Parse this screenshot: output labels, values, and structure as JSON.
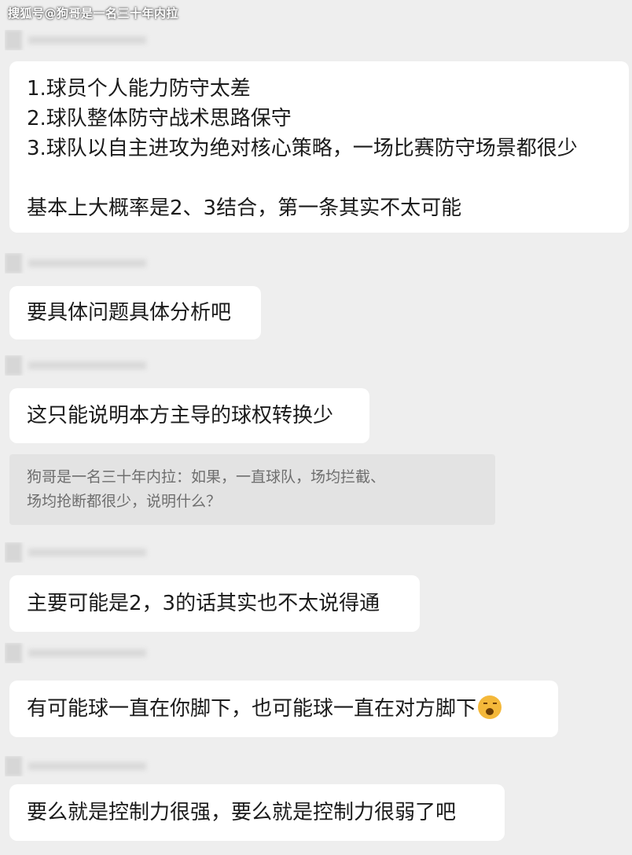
{
  "watermark": "搜狐号@狗哥是一名三十年内拉",
  "messages": [
    {
      "lines": [
        "1.球员个人能力防守太差",
        "2.球队整体防守战术思路保守",
        "3.球队以自主进攻为绝对核心策略，一场比赛防守场景都很少",
        "",
        "基本上大概率是2、3结合，第一条其实不太可能"
      ]
    },
    {
      "lines": [
        "要具体问题具体分析吧"
      ]
    },
    {
      "lines": [
        "这只能说明本方主导的球权转换少"
      ]
    },
    {
      "lines": [
        "主要可能是2，3的话其实也不太说得通"
      ]
    },
    {
      "lines": [
        "有可能球一直在你脚下，也可能球一直在对方脚下"
      ],
      "emoji": "grimace-emoji"
    },
    {
      "lines": [
        "要么就是控制力很强，要么就是控制力很弱了吧"
      ]
    }
  ],
  "quote": {
    "lines": [
      "狗哥是一名三十年内拉：如果，一直球队，场均拦截、",
      "场均抢断都很少，说明什么？"
    ]
  }
}
